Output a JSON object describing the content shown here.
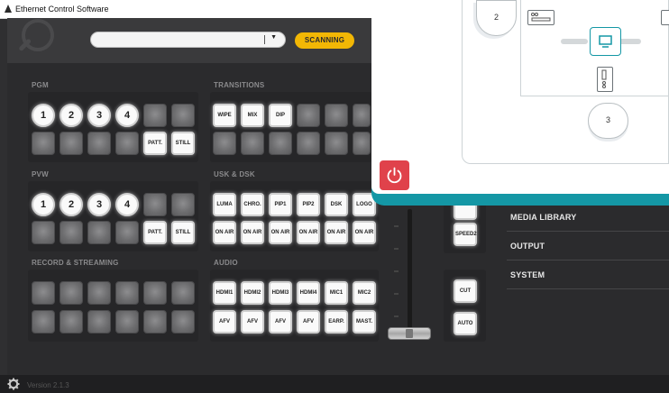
{
  "window": {
    "title": "Ethernet Control Software"
  },
  "topbar": {
    "scan_button": "SCANNING",
    "combo_value": ""
  },
  "sections": {
    "pgm": "PGM",
    "transitions": "TRANSITIONS",
    "pvw": "PVW",
    "usk_dsk": "USK & DSK",
    "record": "RECORD & STREAMING",
    "audio": "AUDIO"
  },
  "pgm": {
    "row1": [
      "1",
      "2",
      "3",
      "4",
      "",
      ""
    ],
    "row2": [
      "",
      "",
      "",
      "",
      "PATT.",
      "STILL"
    ]
  },
  "pvw": {
    "row1": [
      "1",
      "2",
      "3",
      "4",
      "",
      ""
    ],
    "row2": [
      "",
      "",
      "",
      "",
      "PATT.",
      "STILL"
    ]
  },
  "transitions": {
    "row1": [
      "WIPE",
      "MIX",
      "DIP",
      "",
      "",
      ""
    ]
  },
  "usk": {
    "row1": [
      "LUMA",
      "CHRO.",
      "PIP1",
      "PIP2",
      "DSK",
      "LOGO"
    ],
    "row2": [
      "ON AIR",
      "ON AIR",
      "ON AIR",
      "ON AIR",
      "ON AIR",
      "ON AIR"
    ]
  },
  "audio": {
    "row1": [
      "HDMI1",
      "HDMI2",
      "HDMI3",
      "HDMI4",
      "MIC1",
      "MIC2"
    ],
    "row2": [
      "AFV",
      "AFV",
      "AFV",
      "AFV",
      "EARP.",
      "MAST."
    ]
  },
  "transition_controls": {
    "speed": "SPEED2",
    "cut": "CUT",
    "auto": "AUTO"
  },
  "menu": {
    "items": [
      "MEDIA LIBRARY",
      "OUTPUT",
      "SYSTEM"
    ]
  },
  "footer": {
    "version": "Version 2.1.3"
  },
  "popup": {
    "node_left": "2",
    "node_bottom": "3"
  },
  "colors": {
    "accent": "#f2b705",
    "popup_border": "#1497a5",
    "power": "#e0424b",
    "background": "#2b2b2d"
  }
}
